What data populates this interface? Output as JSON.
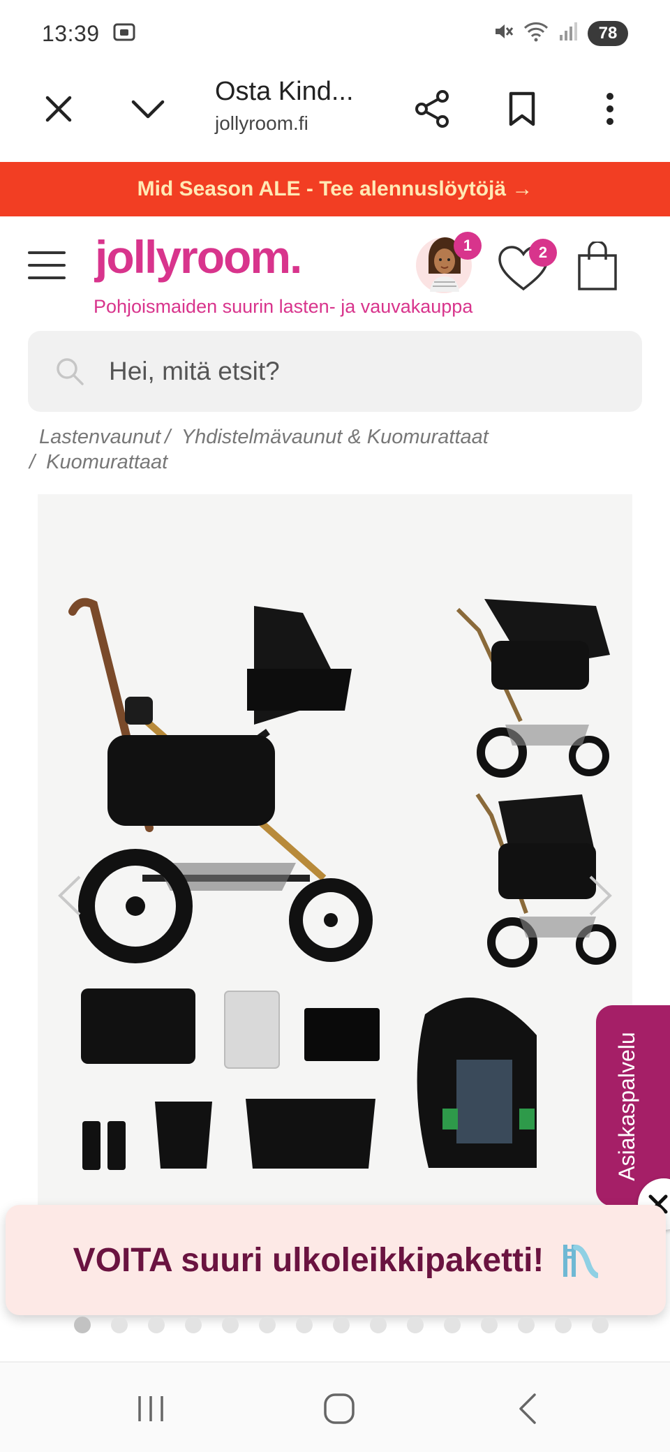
{
  "status_bar": {
    "time": "13:39",
    "battery": "78",
    "icons": [
      "screenshot-icon",
      "mute-icon",
      "wifi-icon",
      "signal-icon"
    ]
  },
  "browser": {
    "tab_title": "Osta Kind...",
    "url": "jollyroom.fi",
    "icons": [
      "close-icon",
      "chevron-down-icon",
      "share-icon",
      "bookmark-icon",
      "more-vert-icon"
    ]
  },
  "promo": {
    "text": "Mid Season ALE - Tee alennuslöytöjä →",
    "background": "#f23e23",
    "color": "#ffe9b5"
  },
  "header": {
    "logo": "jollyroom.",
    "tagline": "Pohjoismaiden suurin lasten- ja vauvakauppa",
    "avatar_badge": "1",
    "wishlist_badge": "2",
    "brand_color": "#d8348c"
  },
  "search": {
    "placeholder": "Hei, mitä etsit?",
    "value": ""
  },
  "breadcrumb": {
    "items": [
      "Lastenvaunut",
      "Yhdistelmävaunut & Kuomurattaat",
      "Kuomurattaat"
    ],
    "separator": "/"
  },
  "gallery": {
    "image_count": 15,
    "active_index": 0
  },
  "customer_service": {
    "label": "Asiakaspalvelu",
    "color": "#a51f67"
  },
  "campaign": {
    "text": "VOITA suuri ulkoleikkipaketti!",
    "emoji": "🛝",
    "text_color": "#6a1340",
    "background": "#fde9e6"
  },
  "nav": {
    "icons": [
      "recents-icon",
      "home-icon",
      "back-icon"
    ]
  }
}
